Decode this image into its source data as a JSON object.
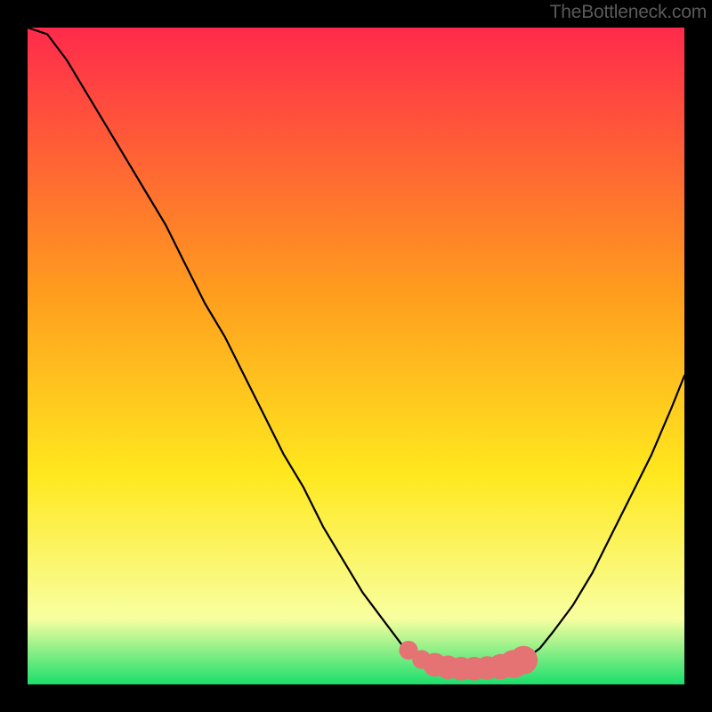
{
  "attribution": "TheBottleneck.com",
  "colors": {
    "background": "#000000",
    "attribution_text": "#5a5a5a",
    "curve": "#000000",
    "marker": "#e57373",
    "gradient_top": "#ff2a4b",
    "gradient_mid1": "#ff9c1e",
    "gradient_mid2": "#ffe81e",
    "gradient_mid3": "#f8ffa0",
    "gradient_bottom": "#1bde6c"
  },
  "chart_data": {
    "type": "line",
    "title": "",
    "xlabel": "",
    "ylabel": "",
    "xlim": [
      0,
      100
    ],
    "ylim": [
      0,
      100
    ],
    "grid": false,
    "legend": false,
    "series": [
      {
        "name": "curve",
        "x": [
          0,
          3,
          6,
          9,
          12,
          15,
          18,
          21,
          24,
          27,
          30,
          33,
          36,
          39,
          42,
          45,
          48,
          51,
          54,
          57,
          60,
          62,
          64,
          66,
          68,
          70,
          72,
          74,
          76,
          78,
          80,
          83,
          86,
          89,
          92,
          95,
          98,
          100
        ],
        "y": [
          100,
          99,
          95,
          90,
          85,
          80,
          75,
          70,
          64,
          58,
          53,
          47,
          41,
          35,
          30,
          24,
          19,
          14,
          10,
          6,
          4,
          3,
          2.5,
          2.3,
          2.3,
          2.5,
          2.8,
          3.2,
          4.0,
          5.5,
          8,
          12,
          17,
          23,
          29,
          35,
          42,
          47
        ]
      }
    ],
    "markers": [
      {
        "x": 58.0,
        "y": 5.2,
        "r": 1.2
      },
      {
        "x": 60.0,
        "y": 3.8,
        "r": 1.2
      },
      {
        "x": 62.0,
        "y": 3.0,
        "r": 1.5
      },
      {
        "x": 64.0,
        "y": 2.6,
        "r": 1.5
      },
      {
        "x": 66.0,
        "y": 2.4,
        "r": 1.5
      },
      {
        "x": 68.0,
        "y": 2.4,
        "r": 1.5
      },
      {
        "x": 70.0,
        "y": 2.5,
        "r": 1.5
      },
      {
        "x": 72.0,
        "y": 2.7,
        "r": 1.6
      },
      {
        "x": 74.0,
        "y": 3.1,
        "r": 1.8
      },
      {
        "x": 75.5,
        "y": 3.7,
        "r": 1.8
      }
    ],
    "gradient_background": true
  }
}
